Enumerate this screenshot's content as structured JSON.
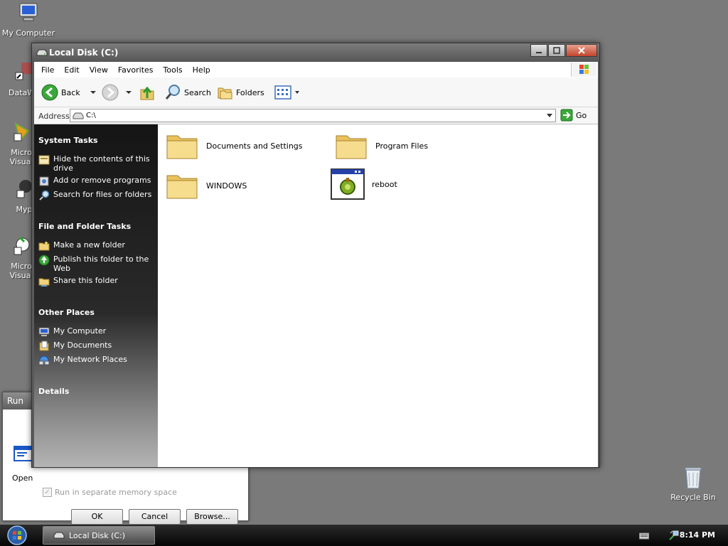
{
  "desktop": {
    "icons": [
      {
        "label": "My Computer"
      },
      {
        "label": "DataWi"
      },
      {
        "label": "Micro"
      },
      {
        "label": "Visual"
      },
      {
        "label": "Myp"
      },
      {
        "label": "Micro"
      },
      {
        "label": "Visual"
      }
    ],
    "recycle_bin": "Recycle Bin"
  },
  "run_dialog": {
    "title": "Run",
    "open_label": "Open",
    "checkbox_label": "Run in separate memory space",
    "ok": "OK",
    "cancel": "Cancel",
    "browse": "Browse..."
  },
  "explorer": {
    "title": "Local Disk (C:)",
    "menu": [
      "File",
      "Edit",
      "View",
      "Favorites",
      "Tools",
      "Help"
    ],
    "toolbar": {
      "back": "Back",
      "search": "Search",
      "folders": "Folders"
    },
    "address": {
      "label": "Address",
      "value": "C:\\",
      "go": "Go"
    },
    "sections": {
      "system_tasks": {
        "title": "System Tasks",
        "items": [
          "Hide the contents of this drive",
          "Add or remove programs",
          "Search for files or folders"
        ]
      },
      "file_folder_tasks": {
        "title": "File and Folder Tasks",
        "items": [
          "Make a new folder",
          "Publish this folder to the Web",
          "Share this folder"
        ]
      },
      "other_places": {
        "title": "Other Places",
        "items": [
          "My Computer",
          "My Documents",
          "My Network Places"
        ]
      },
      "details": {
        "title": "Details"
      }
    },
    "items": [
      {
        "name": "Documents and Settings",
        "icon": "folder-icon"
      },
      {
        "name": "Program Files",
        "icon": "folder-icon"
      },
      {
        "name": "WINDOWS",
        "icon": "folder-icon"
      },
      {
        "name": "reboot",
        "icon": "program-icon"
      }
    ]
  },
  "taskbar": {
    "window_button": "Local Disk (C:)",
    "clock": "8:14 PM"
  }
}
